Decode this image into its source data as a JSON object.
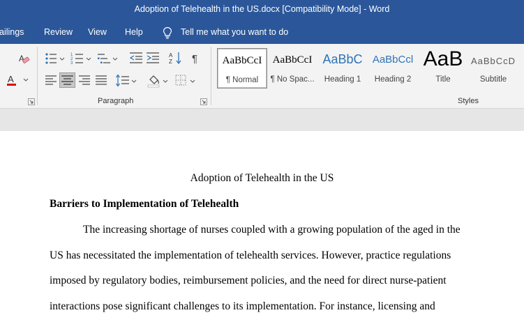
{
  "window": {
    "title": "Adoption of Telehealth in the US.docx [Compatibility Mode]  -  Word"
  },
  "ribbon_tabs": [
    "ailings",
    "Review",
    "View",
    "Help"
  ],
  "tell_me": {
    "label": "Tell me what you want to do",
    "icon": "lightbulb-icon"
  },
  "groups": {
    "paragraph": "Paragraph",
    "styles": "Styles"
  },
  "styles": [
    {
      "preview": "AaBbCcI",
      "label": "¶ Normal",
      "selected": true
    },
    {
      "preview": "AaBbCcI",
      "label": "¶ No Spac..."
    },
    {
      "preview": "AaBbC",
      "label": "Heading 1"
    },
    {
      "preview": "AaBbCcl",
      "label": "Heading 2"
    },
    {
      "preview": "AaB",
      "label": "Title"
    },
    {
      "preview": "AaBbCcD",
      "label": "Subtitle"
    }
  ],
  "colors": {
    "titlebar": "#2b579a",
    "heading_blue": "#2e74b5",
    "font_color_red": "#e00000"
  },
  "document": {
    "title": "Adoption of Telehealth in the US",
    "heading": "Barriers to Implementation of Telehealth",
    "lines": [
      "The increasing shortage of nurses coupled with a growing population of the aged in the",
      "US has necessitated the implementation of telehealth services. However, practice regulations",
      "imposed by regulatory bodies, reimbursement policies, and the need for direct nurse-patient",
      "interactions pose significant challenges to its implementation. For instance, licensing and"
    ]
  }
}
